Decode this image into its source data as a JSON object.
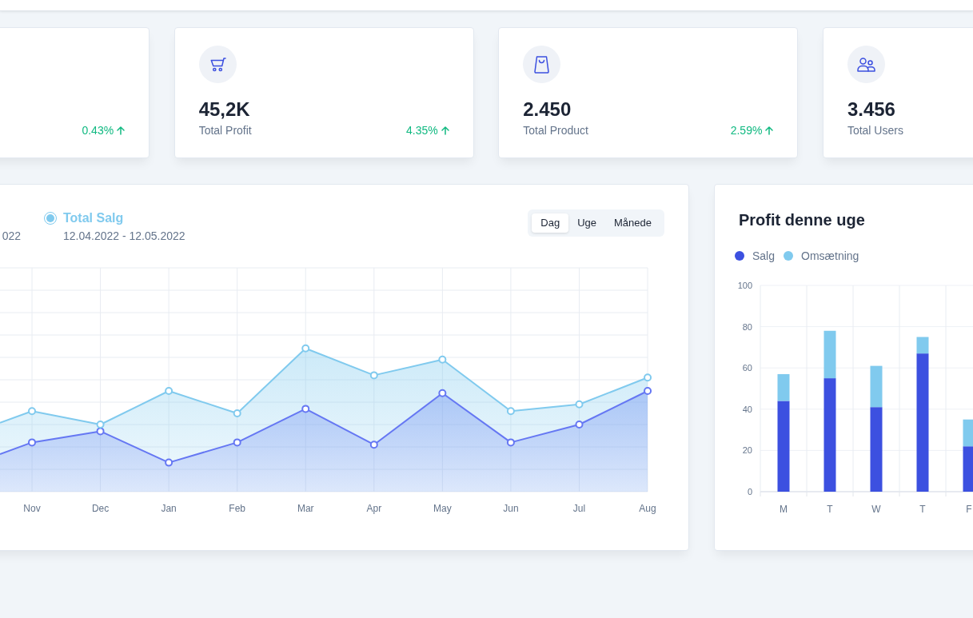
{
  "stats": [
    {
      "change": "0.43%",
      "increase": true
    },
    {
      "value": "45,2K",
      "label": "Total Profit",
      "change": "4.35%",
      "increase": true
    },
    {
      "value": "2.450",
      "label": "Total Product",
      "change": "2.59%",
      "increase": true
    },
    {
      "value": "3.456",
      "label": "Total Users"
    }
  ],
  "line_chart": {
    "legend": [
      {
        "date": "022"
      },
      {
        "title": "Total Salg",
        "date": "12.04.2022 - 12.05.2022",
        "color": "#80caee"
      }
    ],
    "periods": [
      {
        "label": "Dag",
        "selected": true
      },
      {
        "label": "Uge",
        "selected": false
      },
      {
        "label": "Månede",
        "selected": false
      }
    ],
    "month_labels": [
      "Nov",
      "Dec",
      "Jan",
      "Feb",
      "Mar",
      "Apr",
      "May",
      "Jun",
      "Jul",
      "Aug"
    ]
  },
  "bar_chart": {
    "title": "Profit denne uge",
    "chart_data": {
      "type": "bar",
      "stacked": true,
      "grid": true,
      "categories": [
        "M",
        "T",
        "W",
        "T",
        "F"
      ],
      "ylim": [
        0,
        100
      ],
      "yticks": [
        0,
        20,
        40,
        60,
        80,
        100
      ],
      "series": [
        {
          "name": "Salg",
          "color": "#3c50e0",
          "values": [
            44,
            55,
            41,
            67,
            22
          ]
        },
        {
          "name": "Omsætning",
          "color": "#80caee",
          "values": [
            13,
            23,
            20,
            8,
            13
          ]
        }
      ]
    }
  }
}
